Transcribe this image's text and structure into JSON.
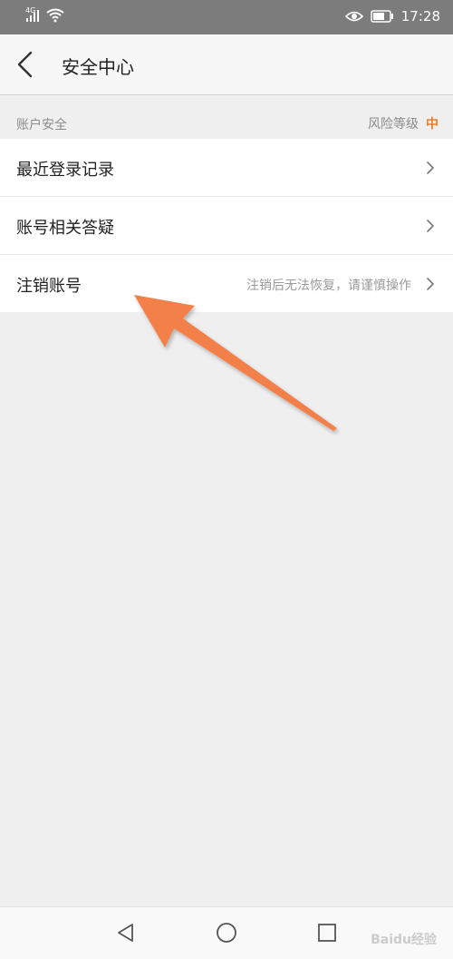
{
  "status": {
    "network": "4G",
    "time": "17:28",
    "icons": [
      "signal-icon",
      "wifi-icon",
      "eye-icon",
      "battery-icon"
    ]
  },
  "header": {
    "title": "安全中心",
    "back_icon": "chevron-left-icon"
  },
  "section": {
    "label": "账户安全",
    "risk_label": "风险等级",
    "risk_level": "中",
    "risk_color": "#e87f2c"
  },
  "items": [
    {
      "label": "最近登录记录",
      "sub": ""
    },
    {
      "label": "账号相关答疑",
      "sub": ""
    },
    {
      "label": "注销账号",
      "sub": "注销后无法恢复，请谨慎操作"
    }
  ],
  "nav": {
    "back": "triangle-back-icon",
    "home": "circle-home-icon",
    "recent": "square-recent-icon"
  },
  "overlay": {
    "arrow_color": "#f4804a"
  },
  "watermark": "Baidu经验"
}
